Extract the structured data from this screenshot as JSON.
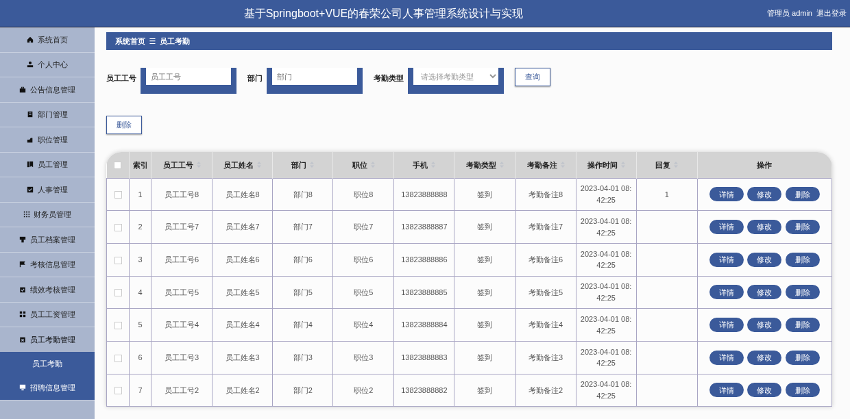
{
  "header": {
    "title": "基于Springboot+VUE的春荣公司人事管理系统设计与实现",
    "user": "管理员 admin",
    "logout": "退出登录"
  },
  "sidebar": {
    "items": [
      {
        "label": "系统首页",
        "expanded": false,
        "highlighted": false
      },
      {
        "label": "个人中心",
        "expanded": false,
        "highlighted": false
      },
      {
        "label": "公告信息管理",
        "expanded": false,
        "highlighted": false
      },
      {
        "label": "部门管理",
        "expanded": false,
        "highlighted": false
      },
      {
        "label": "职位管理",
        "expanded": false,
        "highlighted": false
      },
      {
        "label": "员工管理",
        "expanded": false,
        "highlighted": false
      },
      {
        "label": "人事管理",
        "expanded": false,
        "highlighted": false
      },
      {
        "label": "财务员管理",
        "expanded": false,
        "highlighted": false
      },
      {
        "label": "员工档案管理",
        "expanded": false,
        "highlighted": false
      },
      {
        "label": "考核信息管理",
        "expanded": false,
        "highlighted": false
      },
      {
        "label": "绩效考核管理",
        "expanded": false,
        "highlighted": false
      },
      {
        "label": "员工工资管理",
        "expanded": false,
        "highlighted": false
      },
      {
        "label": "员工考勤管理",
        "expanded": true,
        "highlighted": false,
        "children": [
          {
            "label": "员工考勤",
            "selected": true
          }
        ]
      },
      {
        "label": "招聘信息管理",
        "expanded": false,
        "highlighted": true
      }
    ]
  },
  "breadcrumb": {
    "home": "系统首页",
    "separator": "☰",
    "current": "员工考勤"
  },
  "search": {
    "fields": [
      {
        "label": "员工工号",
        "placeholder": "员工工号",
        "kind": "text"
      },
      {
        "label": "部门",
        "placeholder": "部门",
        "kind": "text"
      },
      {
        "label": "考勤类型",
        "placeholder": "请选择考勤类型",
        "kind": "select"
      }
    ],
    "button": "查询"
  },
  "delete_button": "删除",
  "table": {
    "select_all_checked": false,
    "columns": [
      {
        "label": "索引",
        "sortable": false
      },
      {
        "label": "员工工号",
        "sortable": true
      },
      {
        "label": "员工姓名",
        "sortable": true
      },
      {
        "label": "部门",
        "sortable": true
      },
      {
        "label": "职位",
        "sortable": true
      },
      {
        "label": "手机",
        "sortable": true
      },
      {
        "label": "考勤类型",
        "sortable": true
      },
      {
        "label": "考勤备注",
        "sortable": true
      },
      {
        "label": "操作时间",
        "sortable": true
      },
      {
        "label": "回复",
        "sortable": true
      },
      {
        "label": "操作",
        "sortable": false
      }
    ],
    "rows": [
      {
        "selected": false,
        "cells": [
          "1",
          "员工工号8",
          "员工姓名8",
          "部门8",
          "职位8",
          "13823888888",
          "签到",
          "考勤备注8",
          "2023-04-01 08:42:25",
          "1"
        ]
      },
      {
        "selected": false,
        "cells": [
          "2",
          "员工工号7",
          "员工姓名7",
          "部门7",
          "职位7",
          "13823888887",
          "签到",
          "考勤备注7",
          "2023-04-01 08:42:25",
          ""
        ]
      },
      {
        "selected": false,
        "cells": [
          "3",
          "员工工号6",
          "员工姓名6",
          "部门6",
          "职位6",
          "13823888886",
          "签到",
          "考勤备注6",
          "2023-04-01 08:42:25",
          ""
        ]
      },
      {
        "selected": false,
        "cells": [
          "4",
          "员工工号5",
          "员工姓名5",
          "部门5",
          "职位5",
          "13823888885",
          "签到",
          "考勤备注5",
          "2023-04-01 08:42:25",
          ""
        ]
      },
      {
        "selected": false,
        "cells": [
          "5",
          "员工工号4",
          "员工姓名4",
          "部门4",
          "职位4",
          "13823888884",
          "签到",
          "考勤备注4",
          "2023-04-01 08:42:25",
          ""
        ]
      },
      {
        "selected": false,
        "cells": [
          "6",
          "员工工号3",
          "员工姓名3",
          "部门3",
          "职位3",
          "13823888883",
          "签到",
          "考勤备注3",
          "2023-04-01 08:42:25",
          ""
        ]
      },
      {
        "selected": false,
        "cells": [
          "7",
          "员工工号2",
          "员工姓名2",
          "部门2",
          "职位2",
          "13823888882",
          "签到",
          "考勤备注2",
          "2023-04-01 08:42:25",
          ""
        ]
      }
    ],
    "row_actions": [
      [
        "详情",
        "修改",
        "删除"
      ],
      [
        "详情",
        "修改",
        "删除"
      ],
      [
        "详情",
        "修改",
        "删除"
      ],
      [
        "详情",
        "修改",
        "删除"
      ],
      [
        "详情",
        "修改",
        "删除"
      ],
      [
        "详情",
        "修改",
        "删除"
      ],
      [
        "详情",
        "修改",
        "删除"
      ]
    ]
  }
}
